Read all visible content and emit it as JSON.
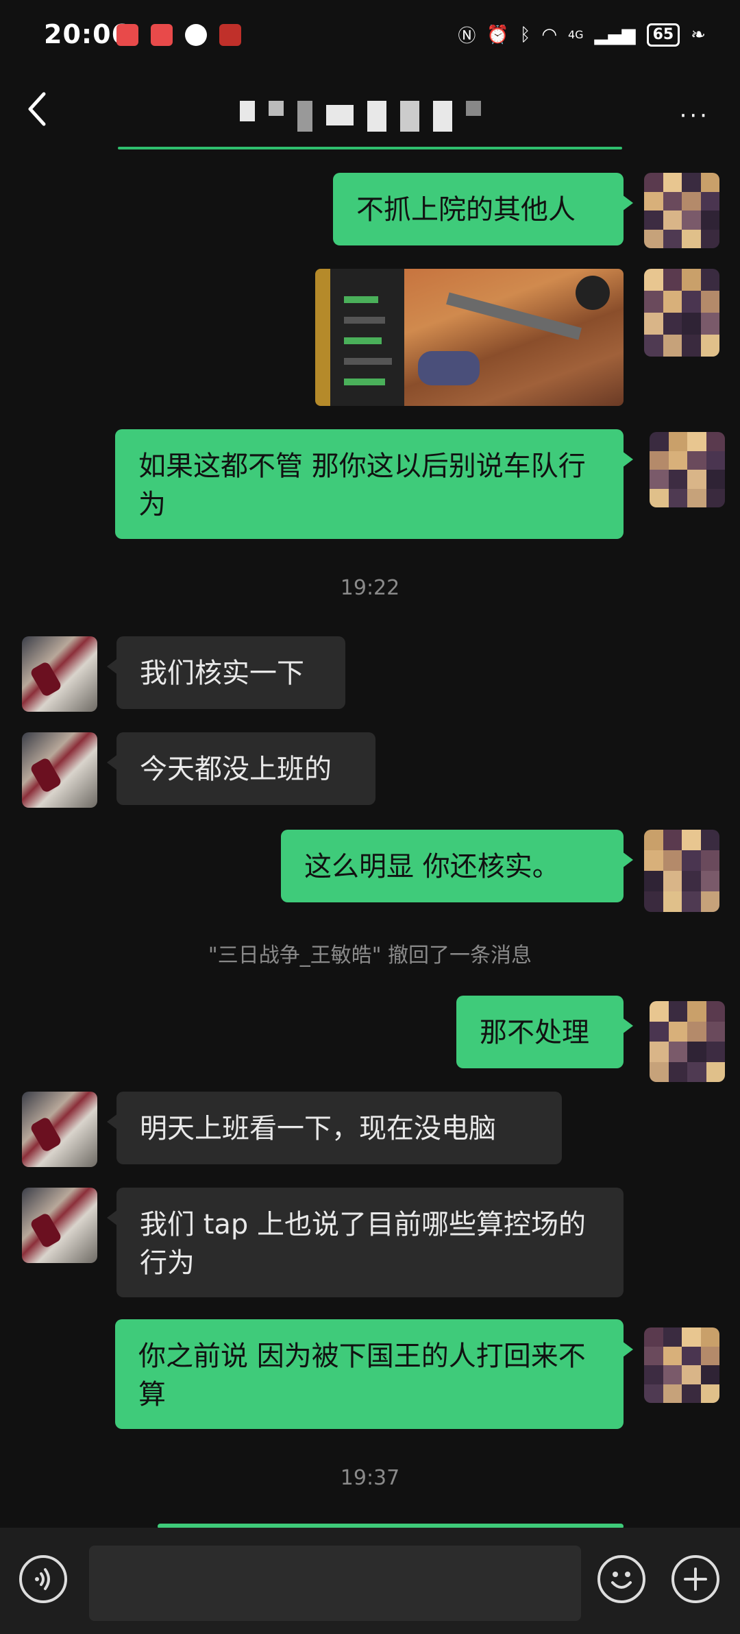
{
  "status_bar": {
    "time": "20:06",
    "battery": "65",
    "network": "4G"
  },
  "header": {
    "back_icon": "chevron-left-icon",
    "more_icon": "more-dots-icon"
  },
  "messages": [
    {
      "id": "m1",
      "side": "out",
      "text": "不抓上院的其他人"
    },
    {
      "id": "m2",
      "side": "out",
      "type": "image"
    },
    {
      "id": "m3",
      "side": "out",
      "text": "如果这都不管 那你这以后别说车队行为"
    },
    {
      "id": "t1",
      "type": "time",
      "text": "19:22"
    },
    {
      "id": "m4",
      "side": "in",
      "text": "我们核实一下"
    },
    {
      "id": "m5",
      "side": "in",
      "text": "今天都没上班的"
    },
    {
      "id": "m6",
      "side": "out",
      "text": "这么明显 你还核实。"
    },
    {
      "id": "s1",
      "type": "system",
      "text": "\"三日战争_王敏皓\" 撤回了一条消息"
    },
    {
      "id": "m7",
      "side": "out",
      "text": "那不处理"
    },
    {
      "id": "m8",
      "side": "in",
      "text": "明天上班看一下，现在没电脑"
    },
    {
      "id": "m9",
      "side": "in",
      "text": "我们 tap 上也说了目前哪些算控场的行为"
    },
    {
      "id": "m10",
      "side": "out",
      "text": "你之前说 因为被下国王的人打回来不算"
    },
    {
      "id": "t2",
      "type": "time",
      "text": "19:37"
    }
  ],
  "input_bar": {
    "placeholder": "",
    "voice_icon": "voice-icon",
    "emoji_icon": "emoji-icon",
    "plus_icon": "plus-icon"
  },
  "colors": {
    "outgoing_bubble": "#3fcb7a",
    "incoming_bubble": "#2b2b2b",
    "background": "#111111"
  }
}
